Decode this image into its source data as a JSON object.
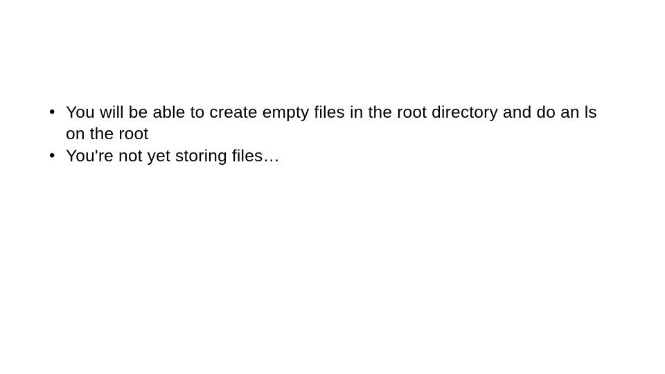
{
  "bullets": [
    "You will be able to create empty files in the root directory and do an ls on the root",
    "You're not yet storing files…"
  ]
}
